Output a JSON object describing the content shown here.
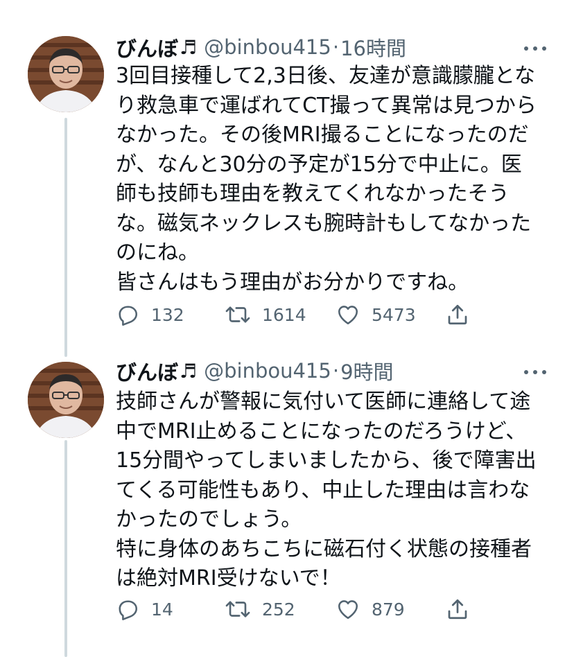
{
  "tweets": [
    {
      "author_name": "びんぼ",
      "author_note_glyph": "♬",
      "handle": "@binbou415",
      "separator": "·",
      "time": "16時間",
      "body_lines": [
        "3回目接種して2,3日後、友達が意識朦朧とな",
        "り救急車で運ばれてCT撮って異常は見つから",
        "なかった。その後MRI撮ることになったのだ",
        "が、なんと30分の予定が15分で中止に。医",
        "師も技師も理由を教えてくれなかったそう",
        "な。磁気ネックレスも腕時計もしてなかった",
        "のにね。",
        "皆さんはもう理由がお分かりですね。"
      ],
      "reply_count": "132",
      "retweet_count": "1614",
      "like_count": "5473"
    },
    {
      "author_name": "びんぼ",
      "author_note_glyph": "♬",
      "handle": "@binbou415",
      "separator": "·",
      "time": "9時間",
      "body_lines": [
        "技師さんが警報に気付いて医師に連絡して途",
        "中でMRI止めることになったのだろうけど、",
        "15分間やってしまいましたから、後で障害出",
        "てくる可能性もあり、中止した理由は言わな",
        "かったのでしょう。",
        "特に身体のあちこちに磁石付く状態の接種者",
        "は絶対MRI受けないで！"
      ],
      "reply_count": "14",
      "retweet_count": "252",
      "like_count": "879"
    }
  ],
  "icons": {
    "reply": "reply-icon",
    "retweet": "retweet-icon",
    "like": "heart-icon",
    "share": "share-icon",
    "more": "more-options-icon"
  },
  "colors": {
    "text": "#0f1419",
    "secondary": "#536471",
    "thread_line": "#cfd9de",
    "background": "#ffffff"
  }
}
